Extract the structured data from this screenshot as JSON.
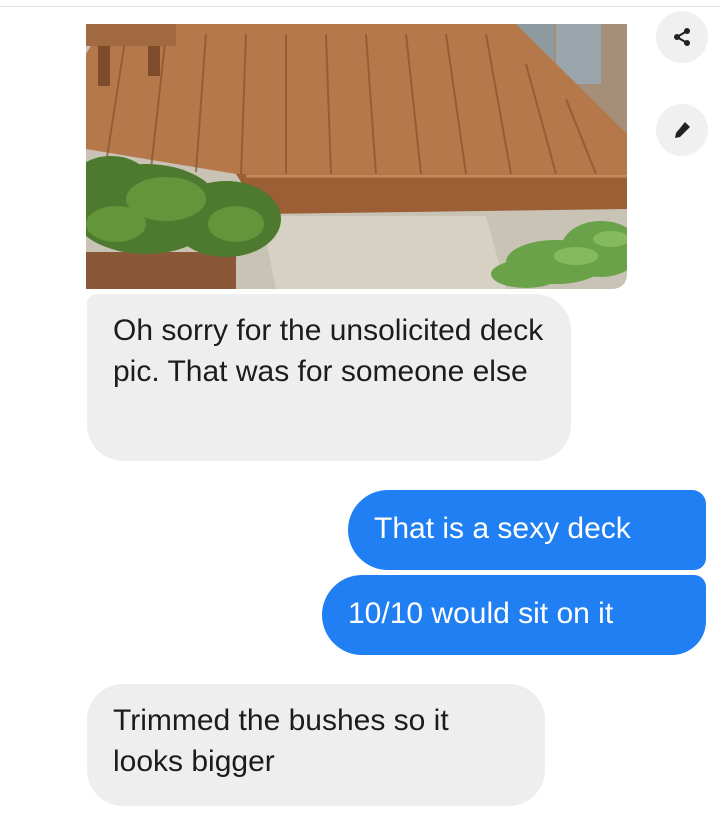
{
  "conversation": {
    "messages": [
      {
        "sender": "them",
        "text": "Oh sorry for the unsolicited deck pic. That was for someone else"
      },
      {
        "sender": "me",
        "text": "That is a sexy deck"
      },
      {
        "sender": "me",
        "text": "10/10 would sit on it"
      },
      {
        "sender": "them",
        "text": "Trimmed the bushes so it looks bigger"
      }
    ]
  },
  "actions": {
    "share_icon": "share-icon",
    "edit_icon": "pencil-icon"
  },
  "colors": {
    "incoming_bubble": "#eeeeee",
    "outgoing_bubble": "#1f7ff3",
    "outgoing_text": "#ffffff",
    "incoming_text": "#1c1c1c"
  }
}
